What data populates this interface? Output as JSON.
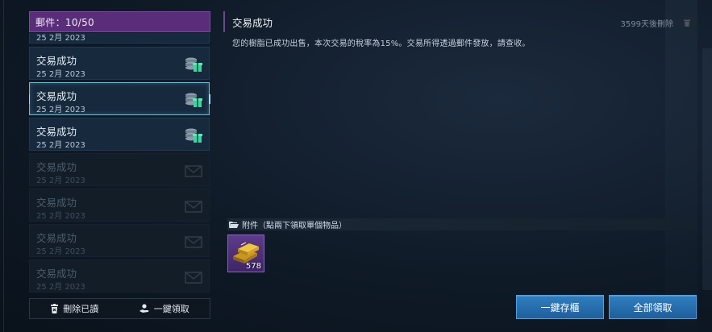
{
  "mailbox": {
    "header_label": "郵件：10/50",
    "partial_date": "25 2月 2023",
    "items": [
      {
        "title": "交易成功",
        "date": "25 2月 2023",
        "state": "unread",
        "icon": "coins-gift-icon"
      },
      {
        "title": "交易成功",
        "date": "25 2月 2023",
        "state": "selected",
        "icon": "coins-gift-icon"
      },
      {
        "title": "交易成功",
        "date": "25 2月 2023",
        "state": "unread",
        "icon": "coins-gift-icon"
      },
      {
        "title": "交易成功",
        "date": "25 2月 2023",
        "state": "read",
        "icon": "envelope-icon"
      },
      {
        "title": "交易成功",
        "date": "25 2月 2023",
        "state": "read",
        "icon": "envelope-icon"
      },
      {
        "title": "交易成功",
        "date": "25 2月 2023",
        "state": "read",
        "icon": "envelope-icon"
      },
      {
        "title": "交易成功",
        "date": "25 2月 2023",
        "state": "read",
        "icon": "envelope-icon"
      }
    ],
    "delete_read_label": "刪除已讀",
    "claim_all_label": "一鍵領取"
  },
  "detail": {
    "title": "交易成功",
    "expire_text": "3599天後刪除",
    "body": "您的樹脂已成功出售，本次交易的稅率為15%。交易所得透過郵件發放，請查收。",
    "attachment_header": "附件（點兩下領取單個物品）",
    "attachment": {
      "icon": "gold-bars-icon",
      "count": "578"
    },
    "store_button": "一鍵存櫃",
    "claim_button": "全部領取"
  },
  "colors": {
    "header_purple": "#5a2d7a",
    "button_blue": "#2f7fc0",
    "selected_border": "#5fc0dc",
    "gift_green": "#3fd3a0"
  }
}
